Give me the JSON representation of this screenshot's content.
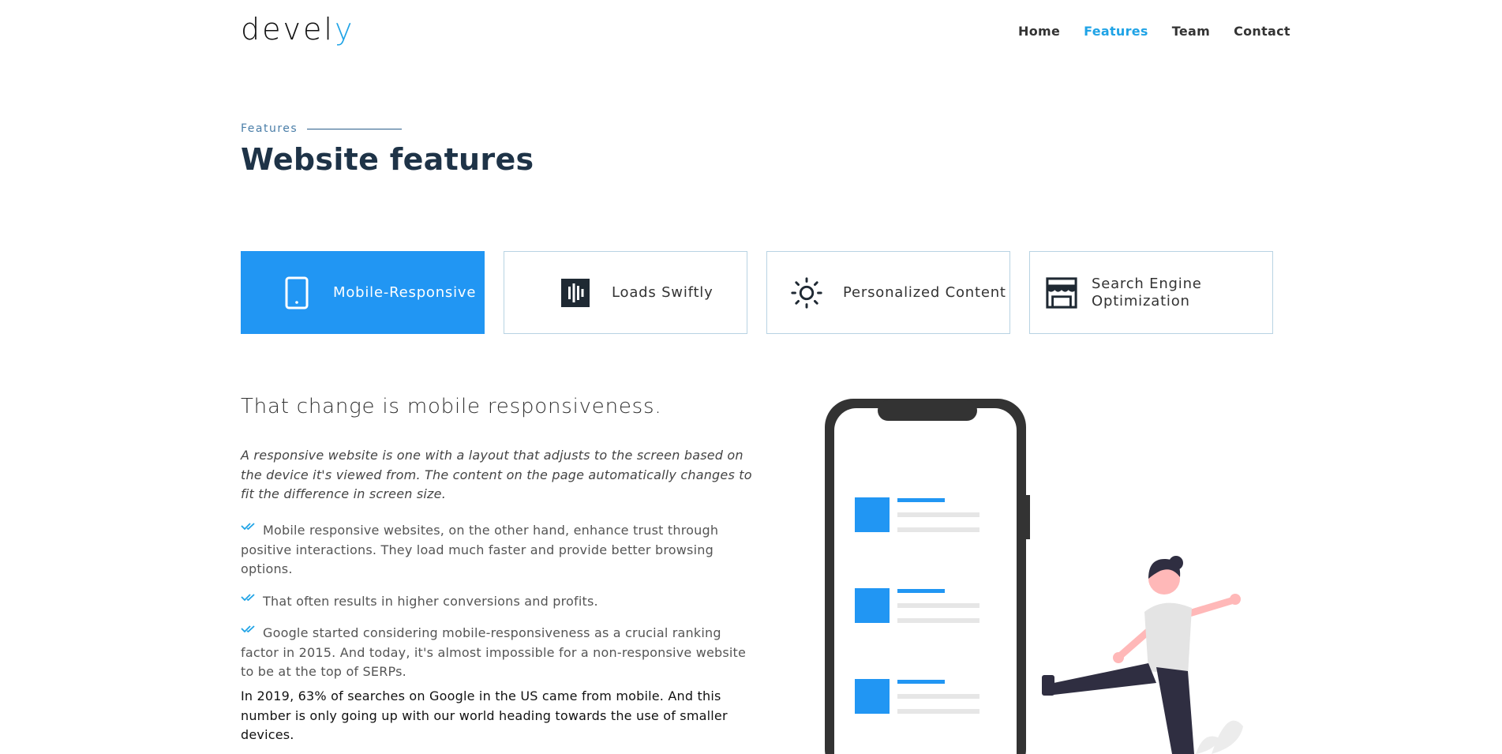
{
  "header": {
    "logo_main": "devel",
    "logo_accent": "y",
    "nav": [
      {
        "label": "Home",
        "active": false
      },
      {
        "label": "Features",
        "active": true
      },
      {
        "label": "Team",
        "active": false
      },
      {
        "label": "Contact",
        "active": false
      }
    ]
  },
  "section": {
    "eyebrow": "Features",
    "title": "Website features"
  },
  "tabs": [
    {
      "label": "Mobile-Responsive",
      "icon": "smartphone-icon",
      "active": true
    },
    {
      "label": "Loads Swiftly",
      "icon": "audio-bars-icon",
      "active": false
    },
    {
      "label": "Personalized Content",
      "icon": "sun-icon",
      "active": false
    },
    {
      "label": "Search Engine Optimization",
      "icon": "storefront-icon",
      "active": false
    }
  ],
  "content": {
    "heading": "That change is mobile responsiveness.",
    "intro": "A responsive website is one with a layout that adjusts to the screen based on the device it's viewed from. The content on the page automatically changes to fit the difference in screen size.",
    "points": [
      "Mobile responsive websites, on the other hand, enhance trust through positive interactions. They load much faster and provide better browsing options.",
      "That often results in higher conversions and profits.",
      "Google started considering mobile-responsiveness as a crucial ranking factor in 2015. And today, it's almost impossible for a non-responsive website to be at the top of SERPs."
    ],
    "closing": "In 2019, 63% of searches on Google in the US came from mobile. And this number is only going up with our world heading towards the use of smaller devices."
  },
  "colors": {
    "accent": "#1fa3e6",
    "tab_active_bg": "#2196f3",
    "heading": "#1e3347",
    "border": "#b8d3e3"
  }
}
